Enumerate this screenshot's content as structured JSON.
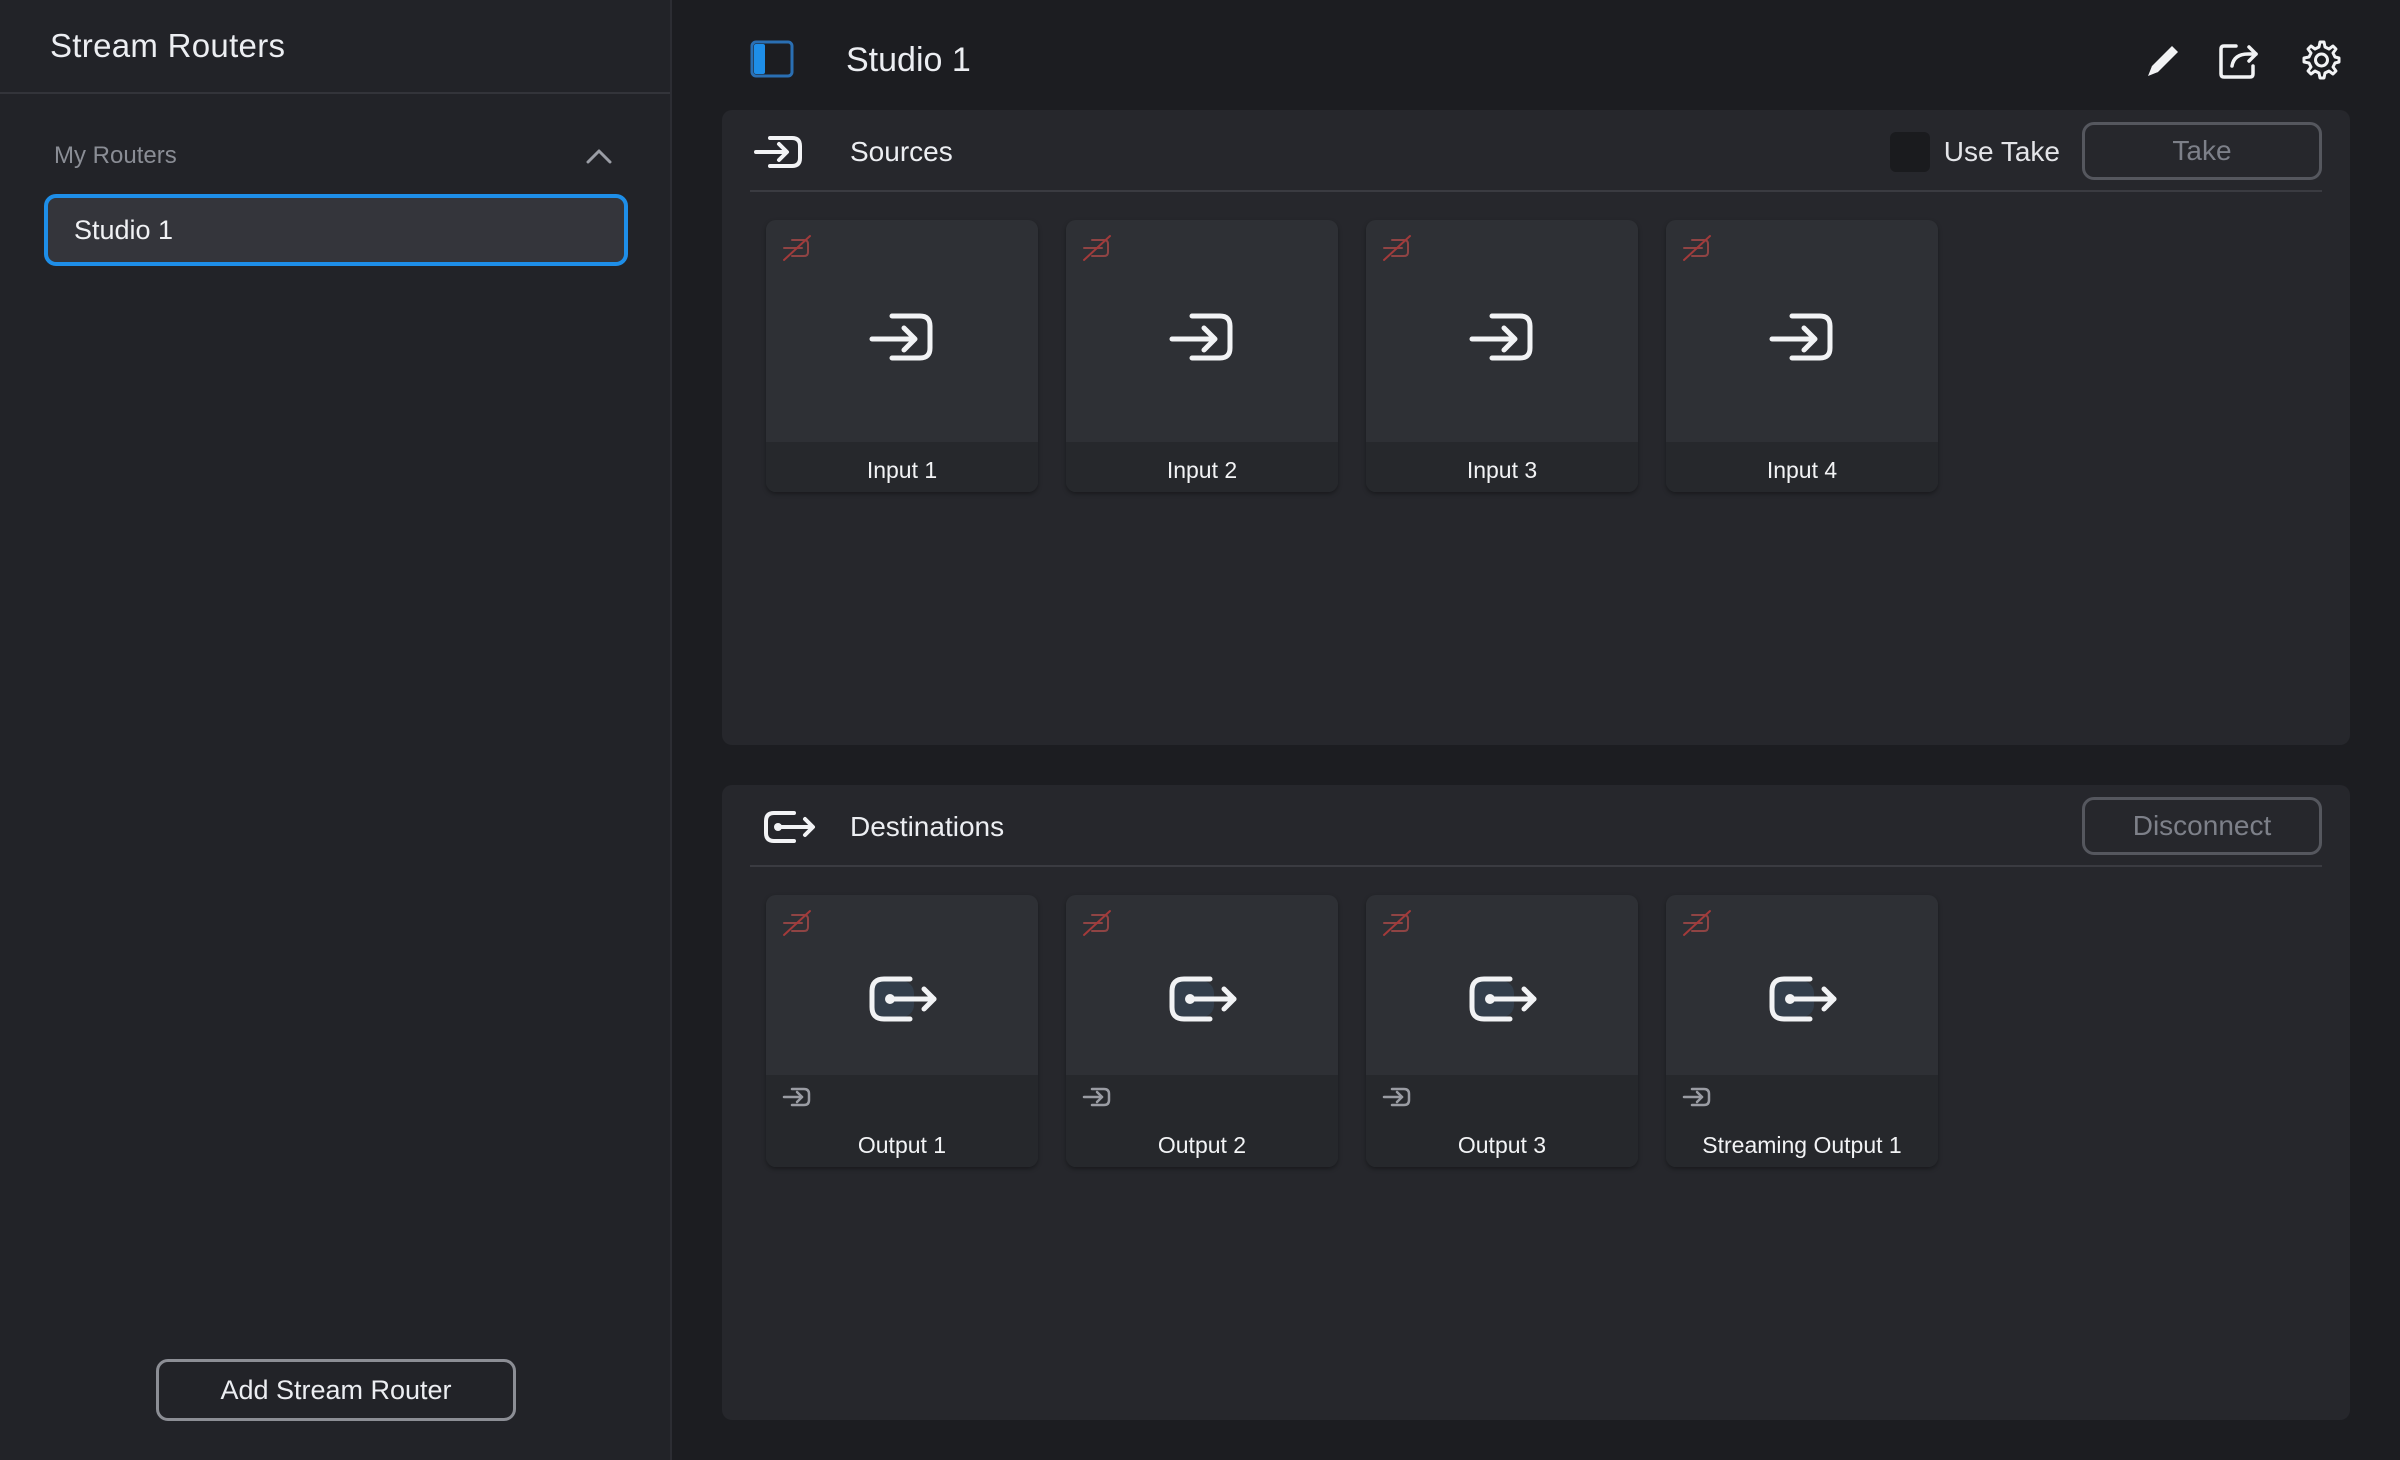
{
  "sidebar": {
    "title": "Stream Routers",
    "group_label": "My Routers",
    "routers": [
      {
        "label": "Studio 1",
        "selected": true
      }
    ],
    "add_button": "Add Stream Router"
  },
  "header": {
    "title": "Studio 1",
    "icons": [
      "panel-toggle-icon",
      "edit-icon",
      "share-icon",
      "settings-icon"
    ]
  },
  "sources": {
    "title": "Sources",
    "use_take_label": "Use Take",
    "use_take_checked": false,
    "take_button": "Take",
    "tiles": [
      {
        "label": "Input 1"
      },
      {
        "label": "Input 2"
      },
      {
        "label": "Input 3"
      },
      {
        "label": "Input 4"
      }
    ]
  },
  "destinations": {
    "title": "Destinations",
    "disconnect_button": "Disconnect",
    "tiles": [
      {
        "label": "Output 1"
      },
      {
        "label": "Output 2"
      },
      {
        "label": "Output 3"
      },
      {
        "label": "Streaming Output 1"
      }
    ]
  },
  "colors": {
    "accent": "#1e8ee8",
    "background": "#1c1d21",
    "sidebar": "#222328",
    "panel": "#26272c",
    "status_inactive": "#a33a3a"
  }
}
